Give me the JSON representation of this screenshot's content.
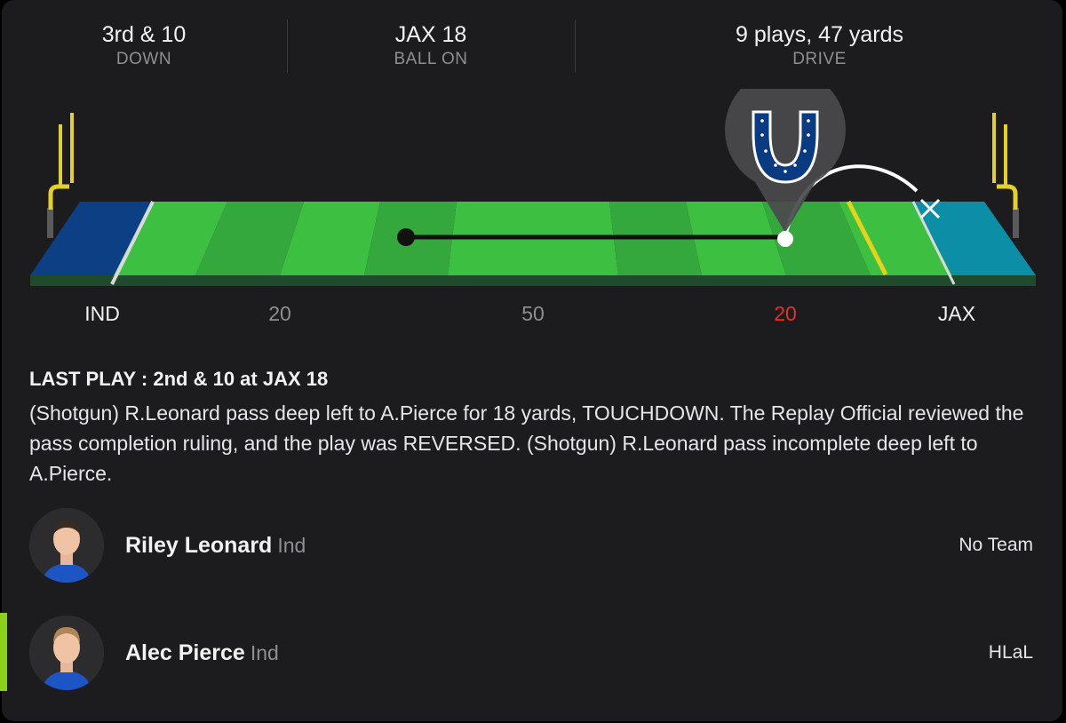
{
  "stats": {
    "down": {
      "value": "3rd & 10",
      "label": "DOWN"
    },
    "ball_on": {
      "value": "JAX 18",
      "label": "BALL ON"
    },
    "drive": {
      "value": "9 plays, 47 yards",
      "label": "DRIVE"
    }
  },
  "field": {
    "yard_labels": {
      "left_team": "IND",
      "left_20": "20",
      "midfield": "50",
      "right_20": "20",
      "right_team": "JAX"
    },
    "colors": {
      "left_endzone": "#0c3f84",
      "right_endzone": "#0b8ea6",
      "field_light": "#3dc042",
      "field_dark": "#34a83c",
      "first_down_line": "#e6d21a",
      "team_logo": "#0a3a80",
      "red_zone_label": "#e0322d"
    },
    "team_logo_icon": "horseshoe-logo-icon"
  },
  "last_play": {
    "heading": "LAST PLAY : 2nd & 10 at JAX 18",
    "description": "(Shotgun) R.Leonard pass deep left to A.Pierce for 18 yards, TOUCHDOWN. The Replay Official reviewed the pass completion ruling, and the play was REVERSED. (Shotgun) R.Leonard pass incomplete deep left to A.Pierce."
  },
  "players": [
    {
      "name": "Riley Leonard",
      "team": "Ind",
      "right": "No Team"
    },
    {
      "name": "Alec Pierce",
      "team": "Ind",
      "right": "HLaL"
    }
  ]
}
